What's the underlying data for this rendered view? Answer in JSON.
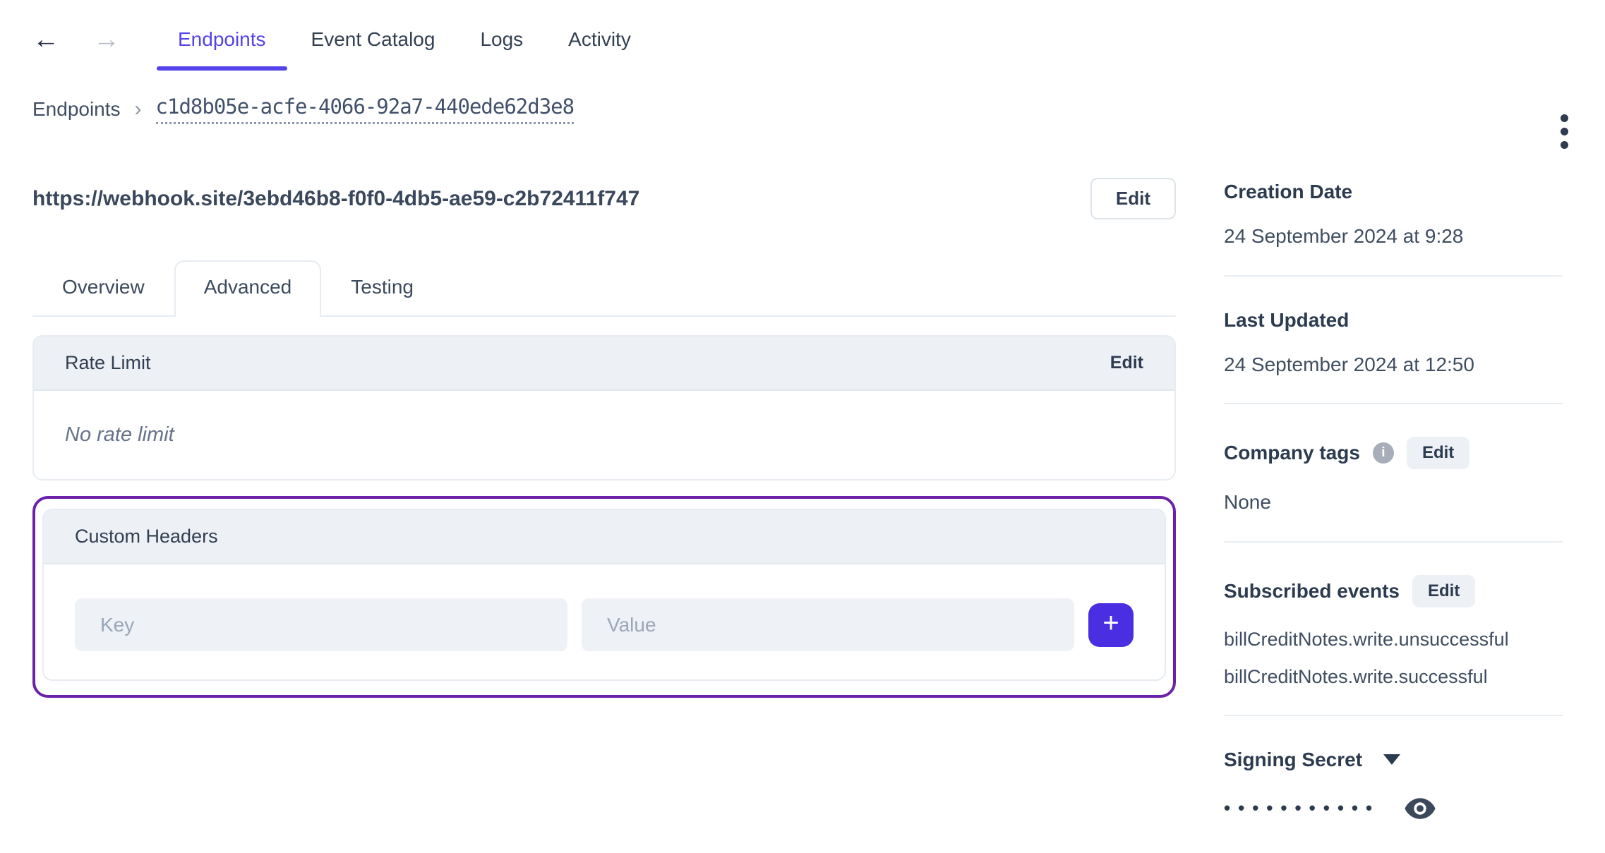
{
  "colors": {
    "accent": "#5443e8",
    "add_button": "#4a2fe2",
    "highlight_outline": "#6b21a8"
  },
  "top_nav": {
    "back_icon": "←",
    "forward_icon": "→",
    "tabs": [
      {
        "label": "Endpoints"
      },
      {
        "label": "Event Catalog"
      },
      {
        "label": "Logs"
      },
      {
        "label": "Activity"
      }
    ],
    "active_tab": "Endpoints"
  },
  "breadcrumb": {
    "root": "Endpoints",
    "separator": "›",
    "endpoint_id": "c1d8b05e-acfe-4066-92a7-440ede62d3e8"
  },
  "endpoint": {
    "url": "https://webhook.site/3ebd46b8-f0f0-4db5-ae59-c2b72411f747",
    "edit_label": "Edit"
  },
  "detail_tabs": {
    "tabs": [
      {
        "label": "Overview"
      },
      {
        "label": "Advanced"
      },
      {
        "label": "Testing"
      }
    ],
    "active_tab": "Advanced"
  },
  "rate_limit": {
    "title": "Rate Limit",
    "edit_label": "Edit",
    "empty_text": "No rate limit"
  },
  "custom_headers": {
    "title": "Custom Headers",
    "key_placeholder": "Key",
    "value_placeholder": "Value",
    "add_label": "+"
  },
  "sidebar": {
    "creation_date": {
      "label": "Creation Date",
      "value": "24 September 2024 at 9:28"
    },
    "last_updated": {
      "label": "Last Updated",
      "value": "24 September 2024 at 12:50"
    },
    "company_tags": {
      "label": "Company tags",
      "info_icon": "i",
      "edit_label": "Edit",
      "value": "None"
    },
    "subscribed_events": {
      "label": "Subscribed events",
      "edit_label": "Edit",
      "events": [
        "billCreditNotes.write.unsuccessful",
        "billCreditNotes.write.successful"
      ]
    },
    "signing_secret": {
      "label": "Signing Secret",
      "masked_value": "•••••••••••"
    }
  }
}
